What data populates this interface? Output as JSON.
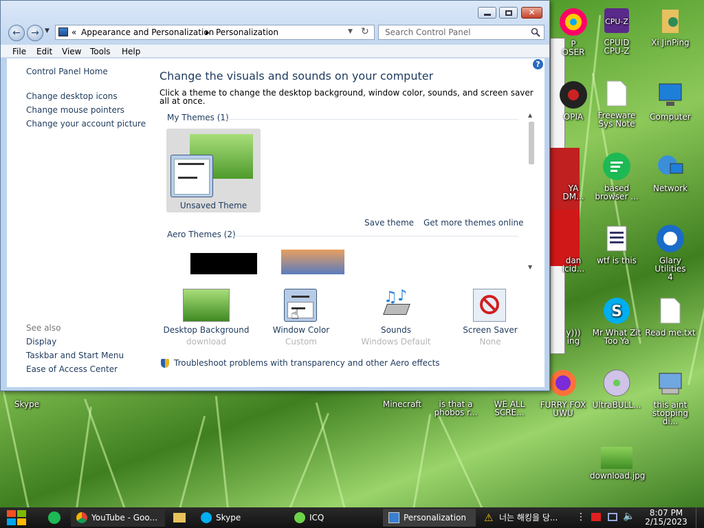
{
  "window": {
    "address_root_icon": "control-panel-icon",
    "address_sep": "«",
    "breadcrumb": [
      "Appearance and Personalization",
      "Personalization"
    ],
    "search_placeholder": "Search Control Panel",
    "menu": [
      "File",
      "Edit",
      "View",
      "Tools",
      "Help"
    ]
  },
  "left_panel": {
    "home": "Control Panel Home",
    "tasks": [
      "Change desktop icons",
      "Change mouse pointers",
      "Change your account picture"
    ],
    "see_also_title": "See also",
    "see_also": [
      "Display",
      "Taskbar and Start Menu",
      "Ease of Access Center"
    ]
  },
  "main": {
    "heading": "Change the visuals and sounds on your computer",
    "description": "Click a theme to change the desktop background, window color, sounds, and screen saver all at once.",
    "my_themes_label": "My Themes (1)",
    "unsaved_theme": "Unsaved Theme",
    "save_theme": "Save theme",
    "get_more": "Get more themes online",
    "aero_label": "Aero Themes (2)",
    "features": [
      {
        "label": "Desktop Background",
        "value": "download"
      },
      {
        "label": "Window Color",
        "value": "Custom"
      },
      {
        "label": "Sounds",
        "value": "Windows Default"
      },
      {
        "label": "Screen Saver",
        "value": "None"
      }
    ],
    "troubleshoot": "Troubleshoot problems with transparency and other Aero effects"
  },
  "desktop_icons": [
    {
      "label": "P\nOSER"
    },
    {
      "label": "CPUID\nCPU-Z"
    },
    {
      "label": "Xi JinPing"
    },
    {
      "label": "OPIA"
    },
    {
      "label": "Freeware\nSys Note"
    },
    {
      "label": "Computer"
    },
    {
      "label": "YA\nDM..."
    },
    {
      "label": "based\nbrowser ..."
    },
    {
      "label": "Network"
    },
    {
      "label": "dan\nicid..."
    },
    {
      "label": "wtf is this"
    },
    {
      "label": "Glary Utilities\n4"
    },
    {
      "label": "y)))\ning"
    },
    {
      "label": "Mr What Zit\nToo Ya"
    },
    {
      "label": "Read me.txt"
    },
    {
      "label": "Skype"
    },
    {
      "label": "Minecraft"
    },
    {
      "label": "is that a\nphobos r..."
    },
    {
      "label": "WE ALL\nSCRE..."
    },
    {
      "label": "FURRY FOX\nUWU"
    },
    {
      "label": "UltraBULL..."
    },
    {
      "label": "this aint\nstopping di..."
    },
    {
      "label": "download.jpg"
    }
  ],
  "taskbar": {
    "items": [
      {
        "label": "YouTube - Goo..."
      },
      {
        "label": "Skype"
      },
      {
        "label": "ICQ"
      },
      {
        "label": "Personalization"
      },
      {
        "label": "너는 해킹을 당..."
      }
    ],
    "time": "8:07 PM",
    "date": "2/15/2023"
  },
  "colors": {
    "link": "#1e3a5e",
    "heading": "#1e3a5e",
    "sublabel": "#b5b5b5",
    "taskbar": "#1a1a1a"
  }
}
